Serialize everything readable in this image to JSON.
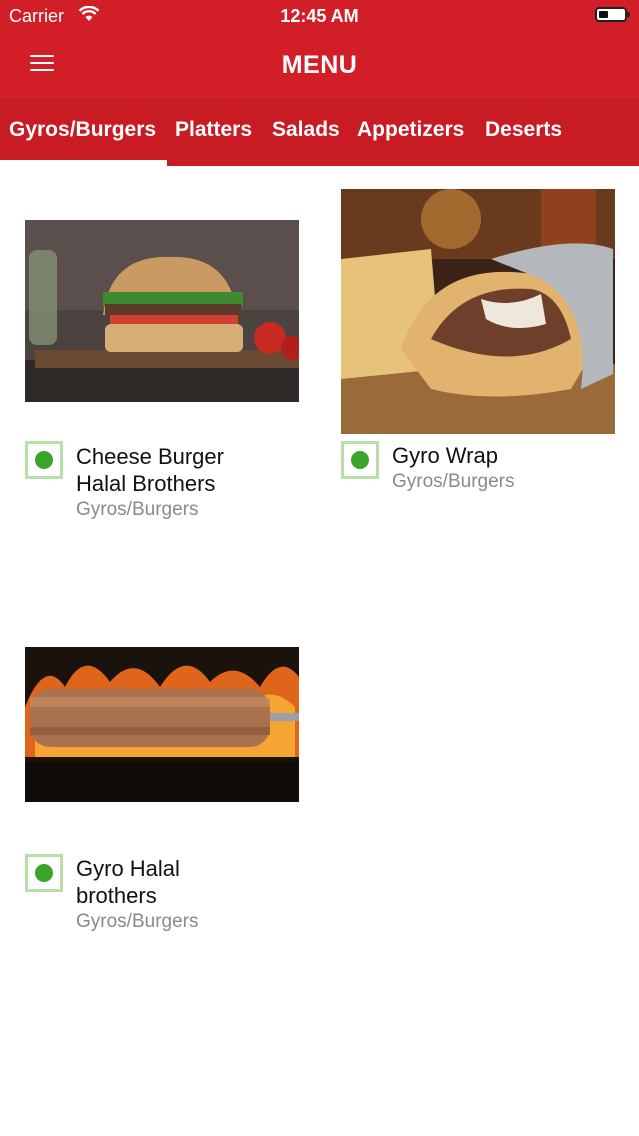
{
  "status_bar": {
    "carrier": "Carrier",
    "time": "12:45 AM"
  },
  "nav": {
    "title": "MENU"
  },
  "tabs": [
    {
      "label": "Gyros/Burgers",
      "selected": true
    },
    {
      "label": "Platters"
    },
    {
      "label": "Salads"
    },
    {
      "label": "Appetizers"
    },
    {
      "label": "Deserts"
    }
  ],
  "items": [
    {
      "name_line1": "Cheese Burger",
      "name_line2": "Halal Brothers",
      "category": "Gyros/Burgers",
      "image": "cheese-burger-photo",
      "veg_indicator": "green"
    },
    {
      "name_line1": "Gyro Wrap",
      "name_line2": "",
      "category": "Gyros/Burgers",
      "image": "gyro-wrap-photo",
      "veg_indicator": "green"
    },
    {
      "name_line1": "Gyro Halal",
      "name_line2": "brothers",
      "category": "Gyros/Burgers",
      "image": "gyro-spit-photo",
      "veg_indicator": "green"
    }
  ],
  "colors": {
    "brand_red": "#d21f27",
    "tab_red": "#c81b24",
    "indicator_green": "#3aa42a",
    "indicator_border": "#b9dfa9"
  }
}
